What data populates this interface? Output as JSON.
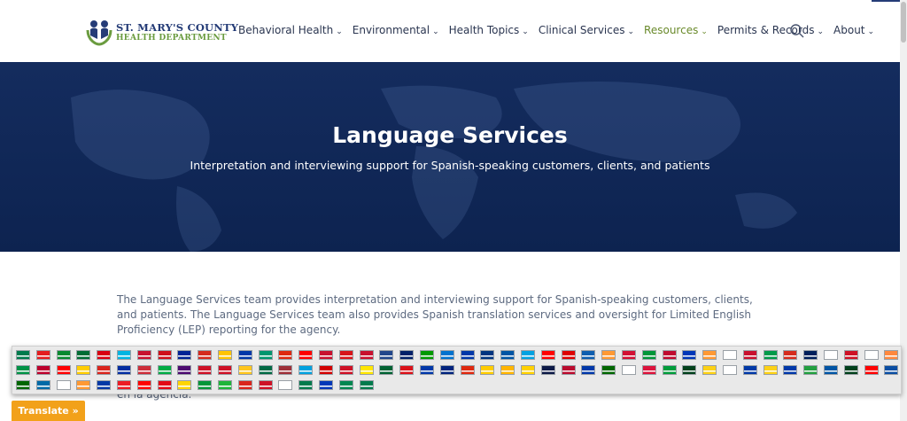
{
  "logo": {
    "line1": "ST. MARY'S COUNTY",
    "line2": "HEALTH DEPARTMENT"
  },
  "nav": {
    "items": [
      {
        "label": "Behavioral Health",
        "active": false
      },
      {
        "label": "Environmental",
        "active": false
      },
      {
        "label": "Health Topics",
        "active": false
      },
      {
        "label": "Clinical Services",
        "active": false
      },
      {
        "label": "Resources",
        "active": true
      },
      {
        "label": "Permits & Records",
        "active": false
      },
      {
        "label": "About",
        "active": false
      }
    ],
    "search_icon": "search-icon"
  },
  "hero": {
    "title": "Language Services",
    "subtitle": "Interpretation and interviewing support for Spanish-speaking customers, clients, and patients"
  },
  "content": {
    "paragraph": "The Language Services team provides interpretation and interviewing support for Spanish-speaking customers, clients, and patients. The Language Services team also provides Spanish translation services and oversight for Limited English Proficiency (LEP) reporting for the agency.",
    "tail": "en la agencia."
  },
  "translate": {
    "label": "Translate »"
  },
  "colors": {
    "brand_blue": "#253c77",
    "brand_green": "#6a9b3f",
    "accent_orange": "#f2a11a",
    "hero_bg": "#142c5e"
  },
  "flags": {
    "rows": [
      [
        "#007a4d",
        "#e41e20",
        "#078930",
        "#006c35",
        "#d90012",
        "#00b5e2",
        "#c8102e",
        "#cf101a",
        "#002395",
        "#d52b1e",
        "#ffc400",
        "#0038a8",
        "#00966e",
        "#de2910",
        "#fe0000",
        "#c8102e",
        "#d7141a",
        "#c8102e",
        "#21468b",
        "#012169",
        "#009900",
        "#0072ce",
        "#0038a8",
        "#003580",
        "#0055a4",
        "#00a2e1",
        "#ff0000",
        "#dd0000",
        "#0d5eaf",
        "#ff9933",
        "#d21034",
        "#009639",
        "#bf0a30",
        "#0038b8",
        "#ff9933",
        "#ffffff",
        "#c8102e",
        "#009a49",
        "#d52b1e",
        "#00205b",
        "#ffffff",
        "#ce1126",
        "#ffffff",
        "#ff883e"
      ],
      [
        "#009246",
        "#bc002d",
        "#ff0000",
        "#ffcd00",
        "#da251d",
        "#032ea1",
        "#cd2e3a",
        "#00ab44",
        "#4c0b70",
        "#ce1126",
        "#ce1126",
        "#ffc61e",
        "#006a44",
        "#9e3039",
        "#00a1de",
        "#d20000",
        "#ce1126",
        "#ffe600",
        "#006233",
        "#da121a",
        "#0038a8",
        "#00247d",
        "#de2910",
        "#ffcc00",
        "#ffb500",
        "#ffd100",
        "#0d1a47",
        "#ba0c2f",
        "#0038a8",
        "#006600",
        "#ffffff",
        "#dc143c",
        "#009c3b",
        "#01411c",
        "#fcd116",
        "#ffffff",
        "#0039a6",
        "#fcd116",
        "#0038a8",
        "#239f40",
        "#0055a4",
        "#01411c",
        "#fe0000",
        "#0b4ea2",
        "#ffffff",
        "#0038a8",
        "#ce1126",
        "#005eb8",
        "#ffffff",
        "#006847",
        "#ce1126"
      ],
      [
        "#006600",
        "#006aa7",
        "#ffffff",
        "#ff9933",
        "#0039a6",
        "#ed1c24",
        "#ff0000",
        "#e30a17",
        "#ffd500",
        "#009639",
        "#1eb53a",
        "#da251d",
        "#ce1126",
        "#ffffff",
        "#007a4d",
        "#0038b8",
        "#008751",
        "#007a4d"
      ]
    ]
  }
}
